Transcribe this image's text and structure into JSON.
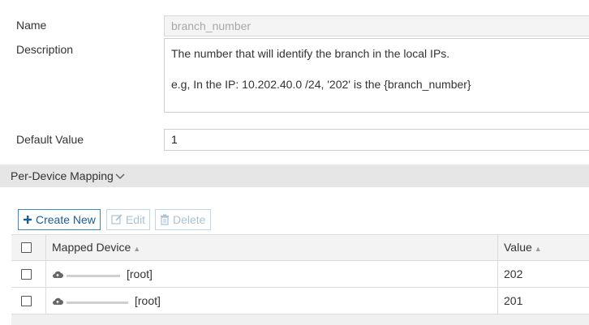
{
  "form": {
    "name_label": "Name",
    "name_value": "branch_number",
    "description_label": "Description",
    "description_lines": [
      "The number that will identify the branch in the local IPs.",
      "e.g, In the IP: 10.202.40.0 /24, '202' is the {branch_number}"
    ],
    "default_label": "Default Value",
    "default_value": "1"
  },
  "section": {
    "title": "Per-Device Mapping"
  },
  "toolbar": {
    "create_label": "Create New",
    "edit_label": "Edit",
    "delete_label": "Delete"
  },
  "table": {
    "columns": [
      "Mapped Device",
      "Value"
    ],
    "rows": [
      {
        "device_suffix": "[root]",
        "value": "202"
      },
      {
        "device_suffix": "[root]",
        "value": "201"
      }
    ]
  },
  "colors": {
    "accent": "#3c87c2",
    "disabled": "#a9c2d8",
    "section_bg": "#e6e6e6"
  },
  "icons": [
    "plus-icon",
    "edit-icon",
    "trash-icon",
    "chevron-down-icon",
    "sort-icon",
    "cloud-icon"
  ]
}
